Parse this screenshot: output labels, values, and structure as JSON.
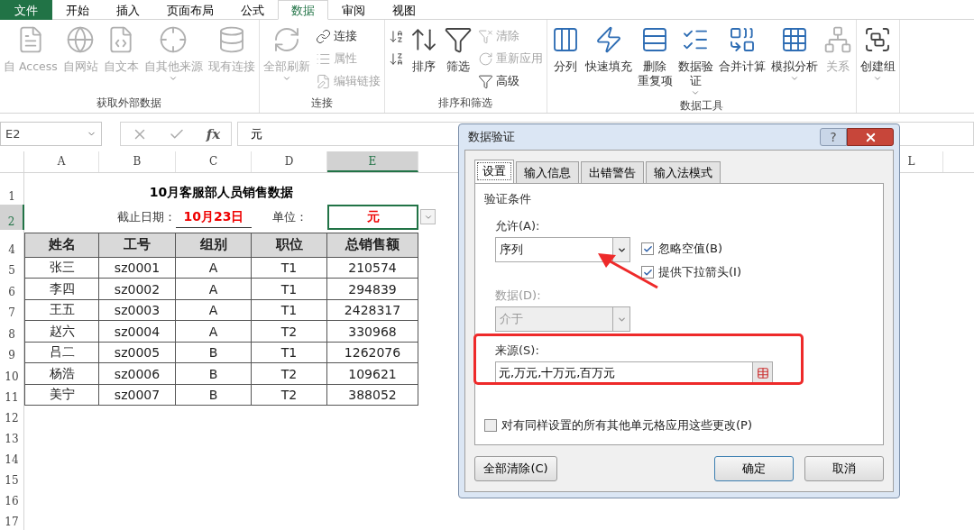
{
  "menu_tabs": [
    {
      "label": "文件",
      "kind": "file",
      "selected": false
    },
    {
      "label": "开始",
      "kind": "tab",
      "selected": false
    },
    {
      "label": "插入",
      "kind": "tab",
      "selected": false
    },
    {
      "label": "页面布局",
      "kind": "tab",
      "selected": false
    },
    {
      "label": "公式",
      "kind": "tab",
      "selected": false
    },
    {
      "label": "数据",
      "kind": "tab",
      "selected": true
    },
    {
      "label": "审阅",
      "kind": "tab",
      "selected": false
    },
    {
      "label": "视图",
      "kind": "tab",
      "selected": false
    }
  ],
  "ribbon": {
    "groups": [
      {
        "label": "获取外部数据",
        "columns": [
          {
            "kind": "large",
            "label": "自 Access",
            "disabled": true
          },
          {
            "kind": "large",
            "label": "自网站",
            "disabled": true
          },
          {
            "kind": "large",
            "label": "自文本",
            "disabled": true
          },
          {
            "kind": "large",
            "label": "自其他来源",
            "disabled": true,
            "has_menu": true
          },
          {
            "kind": "large",
            "label": "现有连接",
            "disabled": true
          }
        ]
      },
      {
        "label": "连接",
        "columns": [
          {
            "kind": "large",
            "label": "全部刷新",
            "disabled": true,
            "has_menu": true
          },
          {
            "kind": "stack",
            "items": [
              {
                "label": "连接",
                "disabled": false
              },
              {
                "label": "属性",
                "disabled": true
              },
              {
                "label": "编辑链接",
                "disabled": true
              }
            ]
          }
        ]
      },
      {
        "label": "排序和筛选",
        "columns": [
          {
            "kind": "stack",
            "items": [
              {
                "disabled": false
              },
              {
                "disabled": false
              }
            ]
          },
          {
            "kind": "large",
            "label": "排序",
            "disabled": false
          },
          {
            "kind": "large",
            "label": "筛选",
            "disabled": false
          },
          {
            "kind": "stack",
            "items": [
              {
                "label": "清除",
                "disabled": true
              },
              {
                "label": "重新应用",
                "disabled": true
              },
              {
                "label": "高级",
                "disabled": false
              }
            ]
          }
        ]
      },
      {
        "label": "数据工具",
        "columns": [
          {
            "kind": "large",
            "label": "分列",
            "disabled": false
          },
          {
            "kind": "large",
            "label": "快速填充",
            "disabled": false
          },
          {
            "kind": "large",
            "label_lines": [
              "删除",
              "重复项"
            ],
            "disabled": false
          },
          {
            "kind": "large",
            "label_lines": [
              "数据验",
              "证"
            ],
            "disabled": false,
            "has_menu": true
          },
          {
            "kind": "large",
            "label": "合并计算",
            "disabled": false
          },
          {
            "kind": "large",
            "label": "模拟分析",
            "disabled": false,
            "has_menu": true
          },
          {
            "kind": "large",
            "label": "关系",
            "disabled": true
          }
        ]
      },
      {
        "columns": [
          {
            "kind": "large",
            "label": "创建组",
            "disabled": false,
            "has_menu": true
          }
        ]
      }
    ]
  },
  "formula_bar": {
    "name_box": "E2",
    "function_label": "fx",
    "value": "元"
  },
  "sheet": {
    "columns": [
      {
        "label": "A",
        "selected": false
      },
      {
        "label": "B",
        "selected": false
      },
      {
        "label": "C",
        "selected": false
      },
      {
        "label": "D",
        "selected": false
      },
      {
        "label": "E",
        "selected": true
      },
      {
        "label": "L",
        "selected": false
      }
    ],
    "rows": [
      {
        "number": "1",
        "selected": false,
        "kind": "title",
        "text": "10月客服部人员销售数据"
      },
      {
        "number": "2",
        "selected": true,
        "kind": "meta",
        "date_label": "截止日期：",
        "date": "10月23日",
        "unit_label": "单位：",
        "unit": "元"
      },
      {
        "kind": "spacer"
      },
      {
        "number": "4",
        "selected": false,
        "kind": "header",
        "cells": [
          "姓名",
          "工号",
          "组别",
          "职位",
          "总销售额"
        ]
      },
      {
        "number": "5",
        "selected": false,
        "kind": "data",
        "cells": [
          "张三",
          "sz0001",
          "A",
          "T1",
          "210574"
        ]
      },
      {
        "number": "6",
        "selected": false,
        "kind": "data",
        "cells": [
          "李四",
          "sz0002",
          "A",
          "T1",
          "294839"
        ]
      },
      {
        "number": "7",
        "selected": false,
        "kind": "data",
        "cells": [
          "王五",
          "sz0003",
          "A",
          "T1",
          "2428317"
        ]
      },
      {
        "number": "8",
        "selected": false,
        "kind": "data",
        "cells": [
          "赵六",
          "sz0004",
          "A",
          "T2",
          "330968"
        ]
      },
      {
        "number": "9",
        "selected": false,
        "kind": "data",
        "cells": [
          "吕二",
          "sz0005",
          "B",
          "T1",
          "1262076"
        ]
      },
      {
        "number": "10",
        "selected": false,
        "kind": "data",
        "cells": [
          "杨浩",
          "sz0006",
          "B",
          "T2",
          "109621"
        ]
      },
      {
        "number": "11",
        "selected": false,
        "kind": "data",
        "cells": [
          "美宁",
          "sz0007",
          "B",
          "T2",
          "388052"
        ]
      },
      {
        "number": "12",
        "selected": false,
        "kind": "empty"
      },
      {
        "number": "13",
        "selected": false,
        "kind": "empty"
      },
      {
        "number": "14",
        "selected": false,
        "kind": "empty"
      },
      {
        "number": "15",
        "selected": false,
        "kind": "empty"
      },
      {
        "number": "16",
        "selected": false,
        "kind": "empty"
      },
      {
        "number": "17",
        "selected": false,
        "kind": "empty"
      }
    ]
  },
  "dialog": {
    "title": "数据验证",
    "help": "?",
    "tabs": [
      {
        "label": "设置",
        "selected": true
      },
      {
        "label": "输入信息",
        "selected": false
      },
      {
        "label": "出错警告",
        "selected": false
      },
      {
        "label": "输入法模式",
        "selected": false
      }
    ],
    "section": "验证条件",
    "allow": {
      "label": "允许(A):",
      "value": "序列"
    },
    "checkboxes": [
      {
        "label": "忽略空值(B)",
        "checked": true
      },
      {
        "label": "提供下拉箭头(I)",
        "checked": true
      }
    ],
    "data": {
      "label": "数据(D):",
      "value": "介于",
      "disabled": true
    },
    "source": {
      "label": "来源(S):",
      "value": "元,万元,十万元,百万元"
    },
    "apply_all": {
      "label": "对有同样设置的所有其他单元格应用这些更改(P)",
      "checked": false
    },
    "buttons": [
      {
        "label": "全部清除(C)",
        "kind": "left"
      },
      {
        "label": "确定",
        "kind": "default"
      },
      {
        "label": "取消",
        "kind": "normal"
      }
    ]
  }
}
